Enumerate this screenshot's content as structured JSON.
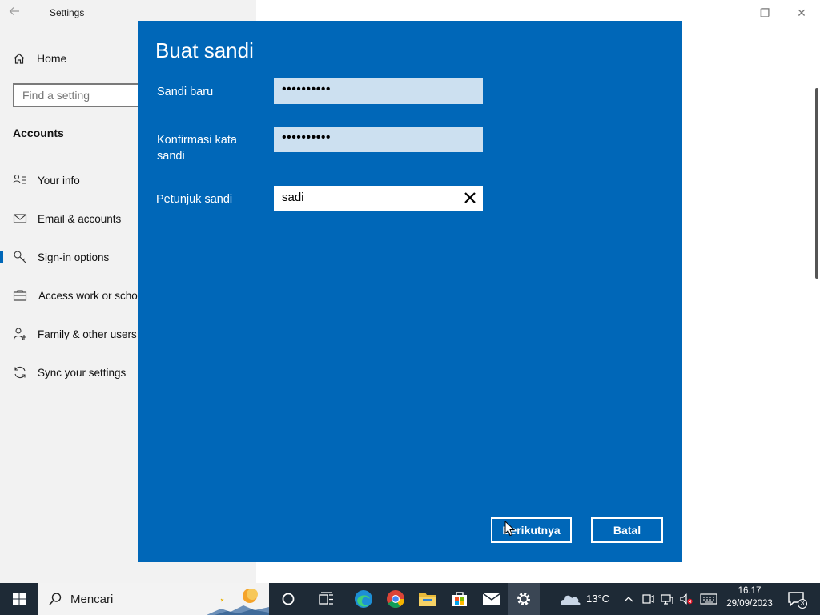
{
  "window": {
    "title": "Settings",
    "controls": {
      "minimize": "–",
      "maximize": "❐",
      "close": "✕"
    }
  },
  "sidebar": {
    "home_label": "Home",
    "search_placeholder": "Find a setting",
    "section_title": "Accounts",
    "items": [
      {
        "label": "Your info",
        "icon": "person-list-icon"
      },
      {
        "label": "Email & accounts",
        "icon": "mail-icon"
      },
      {
        "label": "Sign-in options",
        "icon": "key-icon",
        "selected": true
      },
      {
        "label": "Access work or school",
        "icon": "briefcase-icon"
      },
      {
        "label": "Family & other users",
        "icon": "add-person-icon"
      },
      {
        "label": "Sync your settings",
        "icon": "sync-icon"
      }
    ]
  },
  "dialog": {
    "title": "Buat sandi",
    "fields": {
      "new_password": {
        "label": "Sandi baru",
        "value": "••••••••••"
      },
      "confirm_password": {
        "label": "Konfirmasi kata sandi",
        "value": "••••••••••"
      },
      "hint": {
        "label": "Petunjuk sandi",
        "value": "sadi"
      }
    },
    "buttons": {
      "next": "Berikutnya",
      "cancel": "Batal"
    },
    "accent": "#0067b8"
  },
  "taskbar": {
    "search_placeholder": "Mencari",
    "weather_temp": "13°C",
    "time": "16.17",
    "date": "29/09/2023",
    "notification_count": "3",
    "apps": [
      "cortana-icon",
      "task-view-icon",
      "edge-icon",
      "chrome-icon",
      "file-explorer-icon",
      "store-icon",
      "mail-icon",
      "settings-icon"
    ]
  }
}
